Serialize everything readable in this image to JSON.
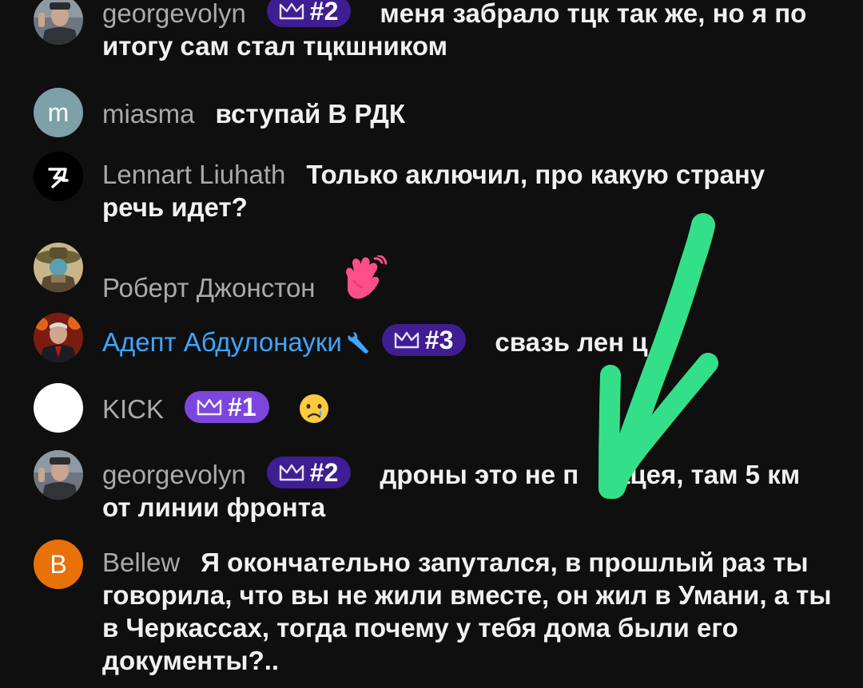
{
  "colors": {
    "background": "#0f0f0f",
    "author_gray": "#aaaaaa",
    "moderator_blue": "#3ea6ff",
    "badge_purple": "#3f1d92",
    "badge_violet": "#7c46de",
    "arrow_green": "#33e089"
  },
  "messages": [
    {
      "author": "georgevolyn",
      "avatar_icon": "photo-avatar-icon",
      "badge": "#2",
      "text": "меня забрало тцк так же, но я по итогу сам стал тцкшником"
    },
    {
      "author": "miasma",
      "avatar_letter": "m",
      "text": "вступай В РДК"
    },
    {
      "author": "Lennart Liuhath",
      "avatar_icon": "lightning-logo-icon",
      "text": "Только аключил, про какую страну речь идет?"
    },
    {
      "author": "Роберт Джонстон",
      "avatar_icon": "photo-avatar-icon",
      "emoji": "waving-hand-emoji"
    },
    {
      "author": "Адепт Абдулонауки",
      "avatar_icon": "photo-avatar-icon",
      "moderator_icon": "wrench-icon",
      "badge": "#3",
      "text": "свазь лен ц"
    },
    {
      "author": "KICK",
      "avatar_icon": "blank-avatar-icon",
      "badge": "#1",
      "emoji": "crying-face-emoji"
    },
    {
      "author": "georgevolyn",
      "avatar_icon": "photo-avatar-icon",
      "badge": "#2",
      "text": "дроны это не п     ацея, там 5 км от линии фронта"
    },
    {
      "author": "Bellew",
      "avatar_letter": "B",
      "text": "Я окончательно запутался, в прошлый раз ты говорила, что вы не жили вместе, он жил в Умани, а ты в Черкассах, тогда почему у тебя дома были его документы?.."
    }
  ]
}
